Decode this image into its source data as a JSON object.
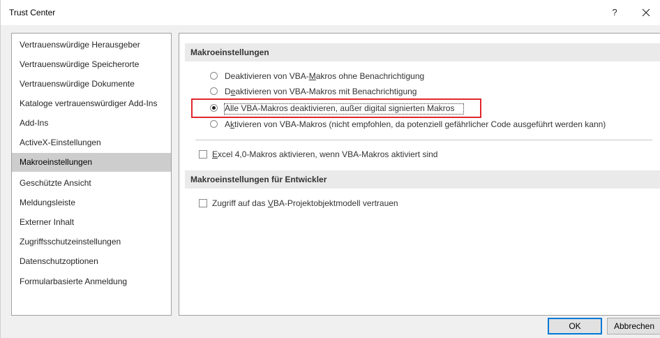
{
  "window": {
    "title": "Trust Center",
    "help_label": "?"
  },
  "nav": {
    "items": [
      {
        "label": "Vertrauenswürdige Herausgeber"
      },
      {
        "label": "Vertrauenswürdige Speicherorte"
      },
      {
        "label": "Vertrauenswürdige Dokumente"
      },
      {
        "label": "Kataloge vertrauenswürdiger Add-Ins"
      },
      {
        "label": "Add-Ins"
      },
      {
        "label": "ActiveX-Einstellungen"
      },
      {
        "label": "Makroeinstellungen"
      },
      {
        "label": "Geschützte Ansicht"
      },
      {
        "label": "Meldungsleiste"
      },
      {
        "label": "Externer Inhalt"
      },
      {
        "label": "Zugriffsschutzeinstellungen"
      },
      {
        "label": "Datenschutzoptionen"
      },
      {
        "label": "Formularbasierte Anmeldung"
      }
    ],
    "selected": "Makroeinstellungen"
  },
  "macro_settings": {
    "header": "Makroeinstellungen",
    "options": [
      {
        "pre": "Deaktivieren von VBA-",
        "key": "M",
        "post": "akros ohne Benachrichtigung",
        "checked": false
      },
      {
        "pre": "D",
        "key": "e",
        "post": "aktivieren von VBA-Makros mit Benachrichtigung",
        "checked": false
      },
      {
        "pre": "Alle VBA-Makros deaktivieren, außer digital signierten Makros",
        "key": "",
        "post": "",
        "checked": true
      },
      {
        "pre": "A",
        "key": "k",
        "post": "tivieren von VBA-Makros (nicht empfohlen, da potenziell gefährlicher Code ausgeführt werden kann)",
        "checked": false
      }
    ],
    "excel4": {
      "pre": "",
      "key": "E",
      "post": "xcel 4,0-Makros aktivieren, wenn VBA-Makros aktiviert sind",
      "checked": false
    }
  },
  "developer_settings": {
    "header": "Makroeinstellungen für Entwickler",
    "vba_access": {
      "pre": "Zugriff auf das ",
      "key": "V",
      "post": "BA-Projektobjektmodell vertrauen",
      "checked": false
    }
  },
  "buttons": {
    "ok": "OK",
    "cancel": "Abbrechen"
  },
  "colors": {
    "highlight": "#e0282d",
    "selected_nav": "#cdcdcd",
    "default_button_border": "#0078d7"
  }
}
